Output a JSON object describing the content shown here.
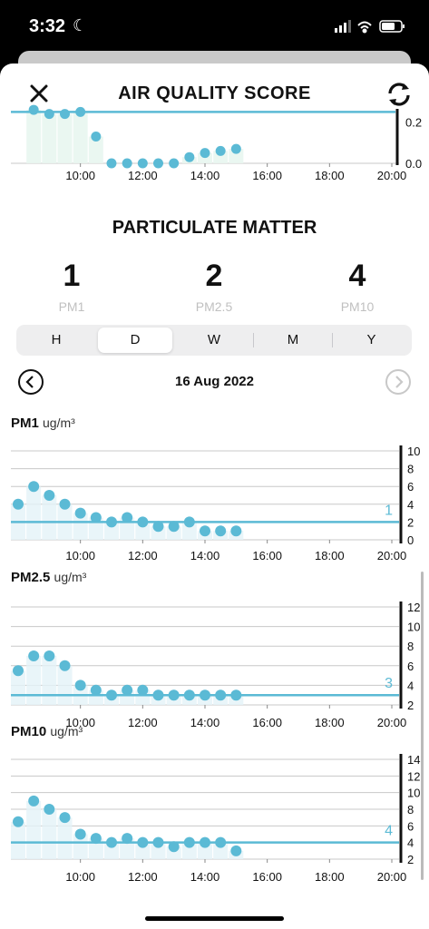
{
  "status": {
    "time": "3:32"
  },
  "header": {
    "title": "AIR QUALITY SCORE"
  },
  "aq_chart": {
    "y_ticks": [
      "0.2",
      "0.0"
    ],
    "x_ticks": [
      "10:00",
      "12:00",
      "14:00",
      "16:00",
      "18:00",
      "20:00"
    ],
    "chart_data": {
      "type": "scatter",
      "title": "AIR QUALITY SCORE",
      "x": [
        "08:30",
        "09:00",
        "09:30",
        "10:00",
        "10:30",
        "11:00",
        "11:30",
        "12:00",
        "12:30",
        "13:00",
        "13:30",
        "14:00",
        "14:30",
        "15:00"
      ],
      "values": [
        0.26,
        0.24,
        0.24,
        0.25,
        0.13,
        0.0,
        0.0,
        0.0,
        0.0,
        0.0,
        0.03,
        0.05,
        0.06,
        0.07
      ],
      "ylim": [
        0,
        0.3
      ],
      "reference_line": 0.25
    }
  },
  "particulate": {
    "title": "PARTICULATE MATTER",
    "items": [
      {
        "value": "1",
        "label": "PM1"
      },
      {
        "value": "2",
        "label": "PM2.5"
      },
      {
        "value": "4",
        "label": "PM10"
      }
    ]
  },
  "range_tabs": [
    "H",
    "D",
    "W",
    "M",
    "Y"
  ],
  "range_selected": "D",
  "date": "16 Aug 2022",
  "charts": [
    {
      "name": "PM1",
      "unit": "ug/m³",
      "current_value": "1",
      "y_ticks": [
        "10",
        "8",
        "6",
        "4",
        "2",
        "0"
      ],
      "x_ticks": [
        "10:00",
        "12:00",
        "14:00",
        "16:00",
        "18:00",
        "20:00"
      ],
      "chart_data": {
        "type": "scatter",
        "title": "PM1",
        "x": [
          "08:00",
          "08:30",
          "09:00",
          "09:30",
          "10:00",
          "10:30",
          "11:00",
          "11:30",
          "12:00",
          "12:30",
          "13:00",
          "13:30",
          "14:00",
          "14:30",
          "15:00"
        ],
        "values": [
          4,
          6,
          5,
          4,
          3,
          2.5,
          2,
          2.5,
          2,
          1.5,
          1.5,
          2,
          1,
          1,
          1
        ],
        "ylim": [
          0,
          10
        ],
        "reference_line": 2
      }
    },
    {
      "name": "PM2.5",
      "unit": "ug/m³",
      "current_value": "3",
      "y_ticks": [
        "12",
        "10",
        "8",
        "6",
        "4",
        "2"
      ],
      "x_ticks": [
        "10:00",
        "12:00",
        "14:00",
        "16:00",
        "18:00",
        "20:00"
      ],
      "chart_data": {
        "type": "scatter",
        "title": "PM2.5",
        "x": [
          "08:00",
          "08:30",
          "09:00",
          "09:30",
          "10:00",
          "10:30",
          "11:00",
          "11:30",
          "12:00",
          "12:30",
          "13:00",
          "13:30",
          "14:00",
          "14:30",
          "15:00"
        ],
        "values": [
          5.5,
          7,
          7,
          6,
          4,
          3.5,
          3,
          3.5,
          3.5,
          3,
          3,
          3,
          3,
          3,
          3
        ],
        "ylim": [
          2,
          12
        ],
        "reference_line": 3
      }
    },
    {
      "name": "PM10",
      "unit": "ug/m³",
      "current_value": "4",
      "y_ticks": [
        "14",
        "12",
        "10",
        "8",
        "6",
        "4",
        "2"
      ],
      "x_ticks": [
        "10:00",
        "12:00",
        "14:00",
        "16:00",
        "18:00",
        "20:00"
      ],
      "chart_data": {
        "type": "scatter",
        "title": "PM10",
        "x": [
          "08:00",
          "08:30",
          "09:00",
          "09:30",
          "10:00",
          "10:30",
          "11:00",
          "11:30",
          "12:00",
          "12:30",
          "13:00",
          "13:30",
          "14:00",
          "14:30",
          "15:00"
        ],
        "values": [
          6.5,
          9,
          8,
          7,
          5,
          4.5,
          4,
          4.5,
          4,
          4,
          3.5,
          4,
          4,
          4,
          3
        ],
        "ylim": [
          2,
          14
        ],
        "reference_line": 4
      }
    }
  ],
  "colors": {
    "accent": "#5bbad5",
    "line": "#5bbad5",
    "grid": "#c8c8c8"
  }
}
